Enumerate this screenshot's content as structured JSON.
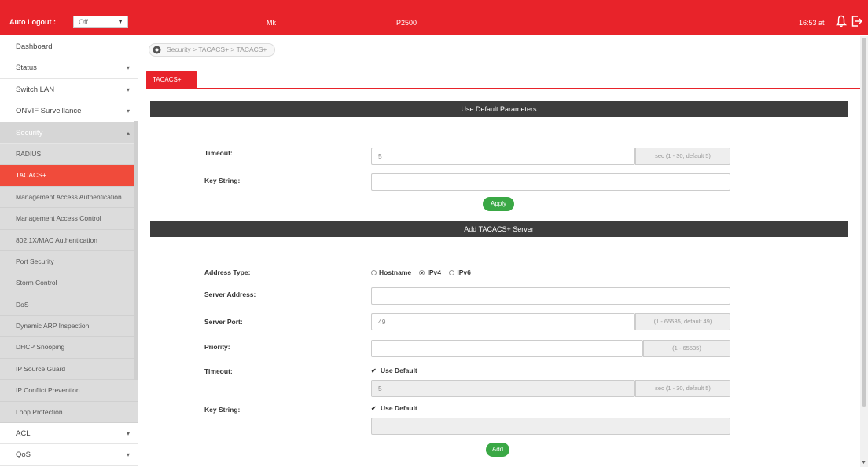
{
  "header": {
    "auto_logout_label": "Auto Logout :",
    "auto_logout_value": "Off",
    "host": "Mk",
    "model": "P2500",
    "time": "16:53 at"
  },
  "breadcrumb": "Security > TACACS+ > TACACS+",
  "sidebar": {
    "top_items": [
      {
        "label": "Dashboard"
      },
      {
        "label": "Status"
      },
      {
        "label": "Switch LAN"
      },
      {
        "label": "ONVIF Surveillance"
      }
    ],
    "security_label": "Security",
    "security_items": [
      {
        "label": "RADIUS"
      },
      {
        "label": "TACACS+"
      },
      {
        "label": "Management Access Authentication"
      },
      {
        "label": "Management Access Control"
      },
      {
        "label": "802.1X/MAC Authentication"
      },
      {
        "label": "Port Security"
      },
      {
        "label": "Storm Control"
      },
      {
        "label": "DoS"
      },
      {
        "label": "Dynamic ARP Inspection"
      },
      {
        "label": "DHCP Snooping"
      },
      {
        "label": "IP Source Guard"
      },
      {
        "label": "IP Conflict Prevention"
      },
      {
        "label": "Loop Protection"
      }
    ],
    "bottom_items": [
      {
        "label": "ACL"
      },
      {
        "label": "QoS"
      }
    ]
  },
  "tab": {
    "label": "TACACS+"
  },
  "default_params": {
    "title": "Use Default Parameters",
    "timeout_label": "Timeout:",
    "timeout_value": "5",
    "timeout_hint": "sec (1 - 30, default 5)",
    "key_label": "Key String:",
    "key_value": "",
    "apply_label": "Apply"
  },
  "add_server": {
    "title": "Add TACACS+ Server",
    "address_type_label": "Address Type:",
    "address_types": [
      "Hostname",
      "IPv4",
      "IPv6"
    ],
    "address_type_selected": "IPv4",
    "server_address_label": "Server Address:",
    "server_address_value": "",
    "server_port_label": "Server Port:",
    "server_port_value": "49",
    "server_port_hint": "(1 - 65535, default 49)",
    "priority_label": "Priority:",
    "priority_value": "",
    "priority_hint": "(1 - 65535)",
    "timeout_label": "Timeout:",
    "timeout_use_default": "Use Default",
    "timeout_value": "5",
    "timeout_hint": "sec (1 - 30, default 5)",
    "key_label": "Key String:",
    "key_use_default": "Use Default",
    "key_value": "",
    "add_label": "Add"
  },
  "colors": {
    "brand": "#e8232a",
    "section_bar": "#3d3d3d",
    "button": "#3aa845",
    "active_nav": "#f04b3b"
  }
}
